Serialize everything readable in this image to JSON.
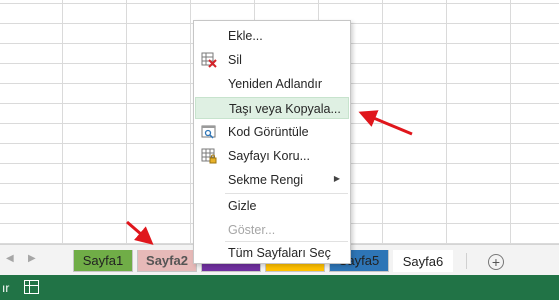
{
  "context_menu": {
    "items": [
      {
        "label": "Ekle...",
        "icon": "",
        "disabled": false,
        "submenu": false,
        "highlighted": false
      },
      {
        "label": "Sil",
        "icon": "delete-sheet-icon",
        "disabled": false,
        "submenu": false,
        "highlighted": false
      },
      {
        "label": "Yeniden Adlandır",
        "icon": "",
        "disabled": false,
        "submenu": false,
        "highlighted": false
      },
      {
        "label": "Taşı veya Kopyala...",
        "icon": "",
        "disabled": false,
        "submenu": false,
        "highlighted": true
      },
      {
        "label": "Kod Görüntüle",
        "icon": "view-code-icon",
        "disabled": false,
        "submenu": false,
        "highlighted": false
      },
      {
        "label": "Sayfayı Koru...",
        "icon": "protect-sheet-icon",
        "disabled": false,
        "submenu": false,
        "highlighted": false
      },
      {
        "label": "Sekme Rengi",
        "icon": "",
        "disabled": false,
        "submenu": true,
        "highlighted": false
      },
      {
        "label": "Gizle",
        "icon": "",
        "disabled": false,
        "submenu": false,
        "highlighted": false
      },
      {
        "label": "Göster...",
        "icon": "",
        "disabled": true,
        "submenu": false,
        "highlighted": false
      },
      {
        "label": "Tüm Sayfaları Seç",
        "icon": "",
        "disabled": false,
        "submenu": false,
        "highlighted": false
      }
    ]
  },
  "sheet_tabs": [
    {
      "label": "Sayfa1",
      "color": "#70ad47",
      "active": false
    },
    {
      "label": "Sayfa2",
      "color": "#e6b9b8",
      "active": true
    },
    {
      "label": "",
      "color": "#7030a0",
      "active": false
    },
    {
      "label": "",
      "color": "#ffc000",
      "active": false
    },
    {
      "label": "Sayfa5",
      "color": "#2e75b6",
      "active": false
    },
    {
      "label": "Sayfa6",
      "color": "#ffffff",
      "active": false
    }
  ],
  "tab_nav": {
    "prev_icon": "◀",
    "next_icon": "▶"
  },
  "add_sheet_icon": "+",
  "status_bar": {
    "text": "ır",
    "color": "#217346"
  },
  "colors": {
    "menu_highlight": "#dff0e3",
    "annotation_arrow": "#e0161c"
  }
}
